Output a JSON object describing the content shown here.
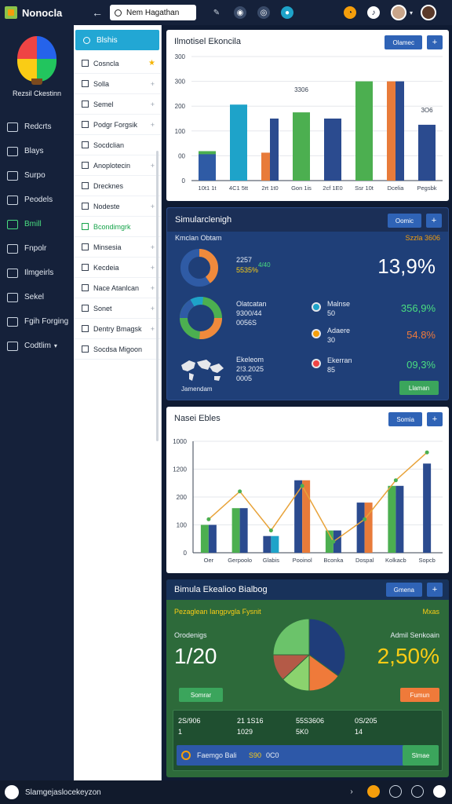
{
  "app": {
    "title": "Nonocla",
    "search_value": "Nem Hagathan",
    "status_text": "Slamgejaslocekeyzon"
  },
  "sidebar": {
    "brand": "Rezsil Ckestinn",
    "items": [
      {
        "label": "Redcrts"
      },
      {
        "label": "Blays"
      },
      {
        "label": "Surpo"
      },
      {
        "label": "Peodels"
      },
      {
        "label": "Bmill",
        "active": true
      },
      {
        "label": "Fnpolr"
      },
      {
        "label": "Ilmgeirls"
      },
      {
        "label": "Sekel"
      },
      {
        "label": "Fgih Forging"
      },
      {
        "label": "Codtlim"
      }
    ]
  },
  "panel2": {
    "header": "Blshis",
    "items": [
      {
        "label": "Cosncla",
        "mark": "star"
      },
      {
        "label": "Solla",
        "mark": "plus"
      },
      {
        "label": "Semel",
        "mark": "plus"
      },
      {
        "label": "Podgr Forgsik",
        "mark": "plus"
      },
      {
        "label": "Socdclian",
        "mark": ""
      },
      {
        "label": "Anoplotecin",
        "mark": "plus"
      },
      {
        "label": "Drecknes",
        "mark": ""
      },
      {
        "label": "Nodeste",
        "mark": "plus"
      },
      {
        "label": "Bcondimgrk",
        "mark": "",
        "green": true
      },
      {
        "label": "Minsesia",
        "mark": "plus"
      },
      {
        "label": "Kecdeia",
        "mark": "plus"
      },
      {
        "label": "Nace Atanlcan",
        "mark": "plus"
      },
      {
        "label": "Sonet",
        "mark": "plus"
      },
      {
        "label": "Dentry Bmagsk",
        "mark": "plus"
      },
      {
        "label": "Socdsa Migoon",
        "mark": ""
      }
    ]
  },
  "card1": {
    "title": "Ilmotisel Ekoncila",
    "button": "Olamec",
    "bar_label_a": "3306",
    "bar_label_b": "3O6",
    "chart_data": {
      "type": "bar",
      "categories": [
        "10t1 1t",
        "4C1 5tt",
        "2rt 1t0",
        "Gon 1is",
        "2cf 1E0",
        "Ssr 10t",
        "Dcelia",
        "Pegsbk"
      ],
      "series": [
        {
          "color": "#2f5ba5",
          "values": [
            85,
            0,
            0,
            0,
            0,
            0,
            0,
            0
          ]
        },
        {
          "color": "#4caf50",
          "values": [
            95,
            0,
            0,
            0,
            0,
            0,
            0,
            0
          ]
        },
        {
          "color": "#1ea3c9",
          "values": [
            0,
            245,
            0,
            0,
            0,
            0,
            0,
            0
          ]
        },
        {
          "color": "#e87b3a",
          "values": [
            0,
            0,
            90,
            0,
            0,
            0,
            320,
            0
          ]
        },
        {
          "color": "#2b4b8f",
          "values": [
            0,
            0,
            200,
            0,
            200,
            0,
            0,
            180
          ]
        },
        {
          "color": "#4caf50",
          "values": [
            0,
            0,
            0,
            220,
            0,
            320,
            0,
            0
          ]
        },
        {
          "color": "#2b4b8f",
          "values": [
            0,
            0,
            0,
            0,
            0,
            0,
            320,
            0
          ]
        }
      ],
      "ticks": [
        "300",
        "300",
        "200",
        "100",
        "00",
        "0"
      ],
      "ylim": [
        0,
        400
      ]
    }
  },
  "card2": {
    "title": "Simularclenigh",
    "button": "Oomic",
    "sub_left": "Kmclan Obtam",
    "sub_right": "Szzla 3606",
    "donut1": {
      "line1": "2257",
      "line2": "5535%",
      "accent": "4/40",
      "big": "13,9%"
    },
    "donut2": {
      "line1": "Olatcatan",
      "line2": "9300/44",
      "line3": "0056S",
      "mid": [
        {
          "label": "Malnse",
          "value": "50"
        },
        {
          "label": "Adaere",
          "value": "30"
        },
        {
          "label": "Ekerran",
          "value": "85"
        }
      ],
      "values": [
        "356,9%",
        "54.8%",
        "09,3%"
      ]
    },
    "map": {
      "line1": "Ekeleom",
      "line2": "2!3.2025",
      "line3": "0005",
      "caption": "Jamendam"
    },
    "green_button": "Llaman"
  },
  "card3": {
    "title": "Nasei Ebles",
    "button": "Somia",
    "chart_data": {
      "type": "bar",
      "categories": [
        "Oer",
        "Gerpoolo",
        "Glabis",
        "Pooinol",
        "Bconka",
        "Dospal",
        "Kolkacb",
        "Sopcb"
      ],
      "ticks": [
        "1000",
        "1200",
        "200",
        "100",
        "0"
      ],
      "ylim": [
        0,
        1000
      ],
      "series": [
        {
          "color": "#4caf50",
          "values": [
            250,
            400,
            0,
            0,
            200,
            0,
            600,
            0
          ]
        },
        {
          "color": "#2b4b8f",
          "values": [
            250,
            400,
            150,
            650,
            200,
            450,
            600,
            800
          ]
        },
        {
          "color": "#e87b3a",
          "values": [
            0,
            0,
            0,
            650,
            0,
            450,
            0,
            0
          ]
        },
        {
          "color": "#1ea3c9",
          "values": [
            0,
            0,
            150,
            0,
            0,
            0,
            0,
            0
          ]
        }
      ],
      "line": {
        "color": "#e8a33a",
        "values": [
          300,
          550,
          200,
          600,
          100,
          300,
          650,
          900
        ]
      }
    }
  },
  "card4": {
    "title": "Bimula Ekealioo Bialbog",
    "button": "Gmena",
    "subtitle": "Pezaglean Iangpvgla Fysnit",
    "sub_right": "Mxas",
    "left": {
      "label": "Orodenigs",
      "value": "1/20"
    },
    "right": {
      "label": "Admil Senkoain",
      "value": "2,50%"
    },
    "chart_data": {
      "type": "pie",
      "values": [
        35,
        15,
        13,
        12,
        25
      ],
      "colors": [
        "#1f3d7a",
        "#ef7a3a",
        "#8bd36e",
        "#b45a47",
        "#6bc36a"
      ]
    },
    "btn_left": "Somrar",
    "btn_right": "Fumun",
    "table": {
      "row1": [
        "2S/906",
        "21 1S16",
        "55S3606",
        "0S/205"
      ],
      "row2": [
        "1",
        "1029",
        "5K0",
        "14"
      ]
    },
    "footer": {
      "text": "Faemgo Bali",
      "n1": "S90",
      "n2": "0C0",
      "btn": "Slmae"
    }
  }
}
